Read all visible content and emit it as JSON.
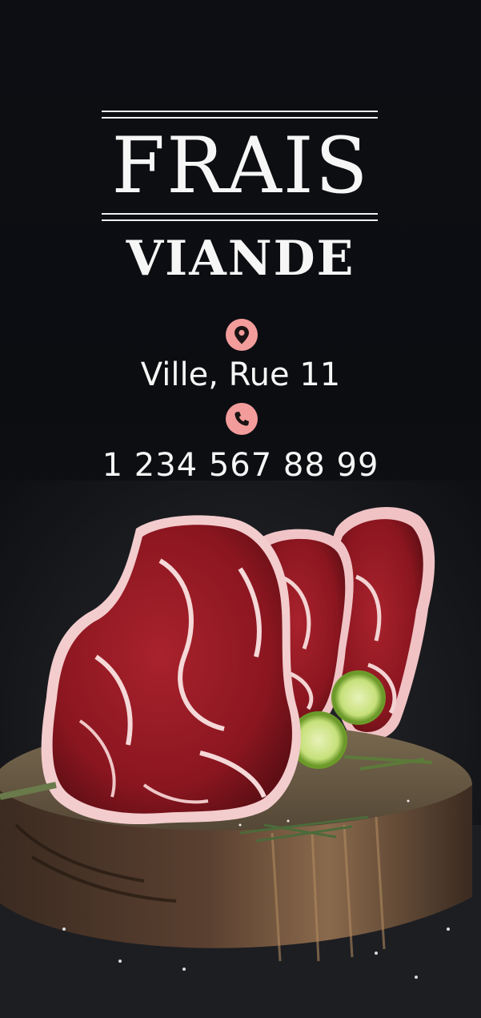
{
  "brand": {
    "title": "FRAIS",
    "subtitle": "VIANDE"
  },
  "contact": {
    "location_icon": "map-pin-icon",
    "address": "Ville, Rue 11",
    "phone_icon": "phone-icon",
    "phone": "1 234 567 88 99"
  },
  "colors": {
    "background": "#0c0d11",
    "text": "#f6f6f6",
    "icon_accent": "#f39c9c"
  }
}
